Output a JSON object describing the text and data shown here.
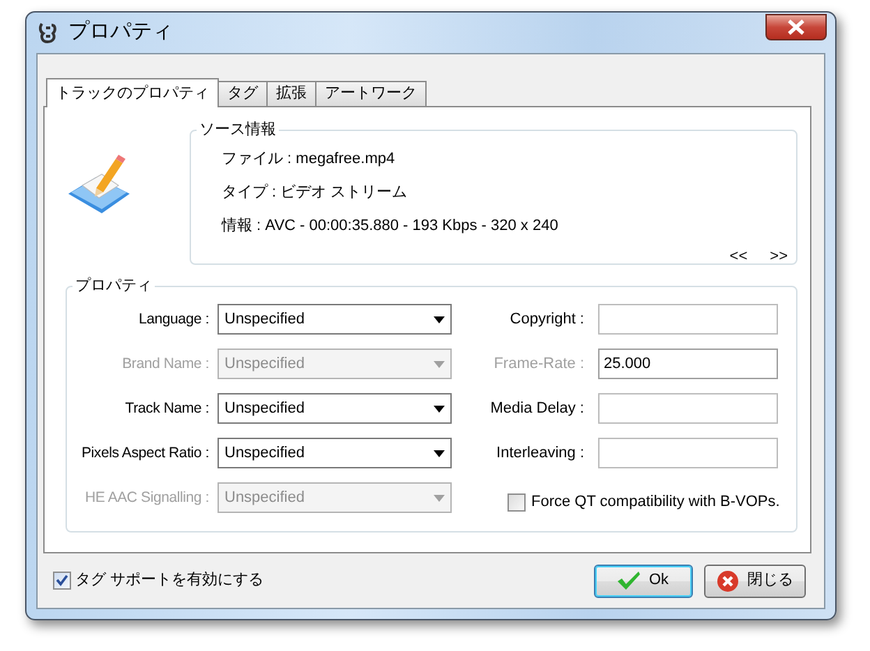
{
  "window": {
    "title": "プロパティ"
  },
  "tabs": [
    {
      "label": "トラックのプロパティ",
      "selected": true
    },
    {
      "label": "タグ",
      "selected": false
    },
    {
      "label": "拡張",
      "selected": false
    },
    {
      "label": "アートワーク",
      "selected": false
    }
  ],
  "source_info": {
    "title": "ソース情報",
    "lines": [
      "ファイル : megafree.mp4",
      "タイプ : ビデオ ストリーム",
      "情報 : AVC - 00:00:35.880 - 193 Kbps - 320 x 240"
    ],
    "prev": "<<",
    "next": ">>"
  },
  "properties": {
    "title": "プロパティ",
    "left_fields": [
      {
        "label": "Language :",
        "value": "Unspecified",
        "disabled": false
      },
      {
        "label": "Brand Name :",
        "value": "Unspecified",
        "disabled": true
      },
      {
        "label": "Track Name :",
        "value": "Unspecified",
        "disabled": false
      },
      {
        "label": "Pixels Aspect Ratio :",
        "value": "Unspecified",
        "disabled": false
      },
      {
        "label": "HE AAC Signalling :",
        "value": "Unspecified",
        "disabled": true
      }
    ],
    "right_fields": [
      {
        "label": "Copyright :",
        "disabled": false
      },
      {
        "label": "Frame-Rate :",
        "value": "25.000",
        "disabled": true
      },
      {
        "label": "Media Delay :",
        "disabled": false
      },
      {
        "label": "Interleaving :",
        "disabled": false
      }
    ],
    "option": {
      "label": "Force QT compatibility with B-VOPs.",
      "checked": false
    }
  },
  "tag_support": {
    "label": "タグ サポートを有効にする",
    "checked": true
  },
  "buttons": [
    {
      "label": "Ok",
      "kind": "ok",
      "default": true
    },
    {
      "label": "閉じる",
      "kind": "close",
      "default": false
    }
  ]
}
